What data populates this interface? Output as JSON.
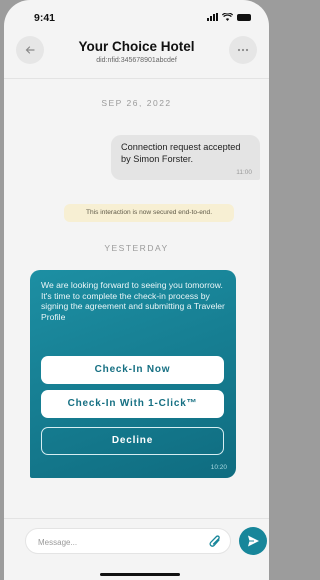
{
  "status_bar": {
    "time": "9:41"
  },
  "header": {
    "title": "Your Choice Hotel",
    "subtitle": "did:nfid:345678901abcdef",
    "back_icon": "arrow-left-icon",
    "more_icon": "more-dots-icon"
  },
  "chat": {
    "date_1": "SEP 26, 2022",
    "outgoing": {
      "text": "Connection request accepted by Simon Forster.",
      "time": "11:00"
    },
    "secure_notice": "This interaction is now secured end-to-end.",
    "date_2": "YESTERDAY",
    "incoming": {
      "text": "We are looking forward to seeing you tomorrow. It's time to complete the check-in process by signing the agreement and submitting a Traveler Profile",
      "buttons": {
        "check_in_now": "Check-In Now",
        "check_in_1click": "Check-In With 1-Click™",
        "decline": "Decline"
      },
      "time": "10:20"
    }
  },
  "composer": {
    "placeholder": "Message...",
    "attach_icon": "paperclip-icon",
    "send_icon": "send-icon"
  },
  "colors": {
    "accent": "#17869a",
    "bubble_in": "#1d8fa3",
    "secure_bg": "#f7efd3"
  }
}
